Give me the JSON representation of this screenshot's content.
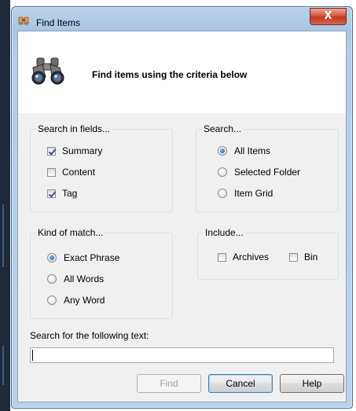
{
  "window": {
    "title": "Find Items",
    "close_label": "X"
  },
  "header": {
    "text": "Find items using the criteria below"
  },
  "search_in_fields": {
    "title": "Search in fields...",
    "options": [
      {
        "label": "Summary",
        "checked": true
      },
      {
        "label": "Content",
        "checked": false
      },
      {
        "label": "Tag",
        "checked": true
      }
    ]
  },
  "search_scope": {
    "title": "Search...",
    "options": [
      {
        "label": "All Items",
        "selected": true
      },
      {
        "label": "Selected Folder",
        "selected": false
      },
      {
        "label": "Item Grid",
        "selected": false
      }
    ]
  },
  "kind_of_match": {
    "title": "Kind of match...",
    "options": [
      {
        "label": "Exact Phrase",
        "selected": true
      },
      {
        "label": "All Words",
        "selected": false
      },
      {
        "label": "Any Word",
        "selected": false
      }
    ]
  },
  "include": {
    "title": "Include...",
    "options": [
      {
        "label": "Archives",
        "checked": false
      },
      {
        "label": "Bin",
        "checked": false
      }
    ]
  },
  "search_text": {
    "label": "Search for the following text:",
    "value": ""
  },
  "buttons": {
    "find": "Find",
    "cancel": "Cancel",
    "help": "Help"
  },
  "icons": {
    "app": "find-items-icon",
    "header": "binoculars-icon",
    "close": "close-icon"
  }
}
